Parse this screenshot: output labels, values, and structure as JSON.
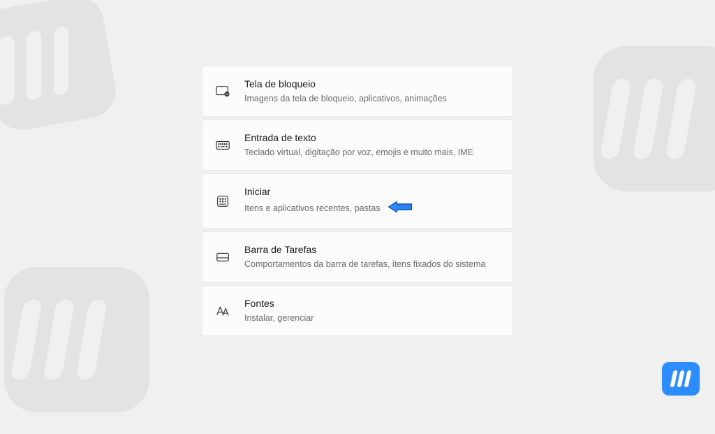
{
  "settings": [
    {
      "key": "lockscreen",
      "title": "Tela de bloqueio",
      "desc": "Imagens da tela de bloqueio, aplicativos, animações",
      "icon": "lock-screen-icon"
    },
    {
      "key": "textinput",
      "title": "Entrada de texto",
      "desc": "Teclado virtual, digitação por voz, emojis e muito mais, IME",
      "icon": "keyboard-icon"
    },
    {
      "key": "start",
      "title": "Iniciar",
      "desc": "Itens e aplicativos recentes, pastas",
      "icon": "start-menu-icon",
      "highlighted": true
    },
    {
      "key": "taskbar",
      "title": "Barra de Tarefas",
      "desc": "Comportamentos da barra de tarefas, itens fixados do sistema",
      "icon": "taskbar-icon"
    },
    {
      "key": "fonts",
      "title": "Fontes",
      "desc": "Instalar, gerenciar",
      "icon": "fonts-icon"
    }
  ],
  "colors": {
    "arrow_fill": "#2d8cff",
    "arrow_stroke": "#0a4aa0",
    "brand": "#2d8cff"
  }
}
